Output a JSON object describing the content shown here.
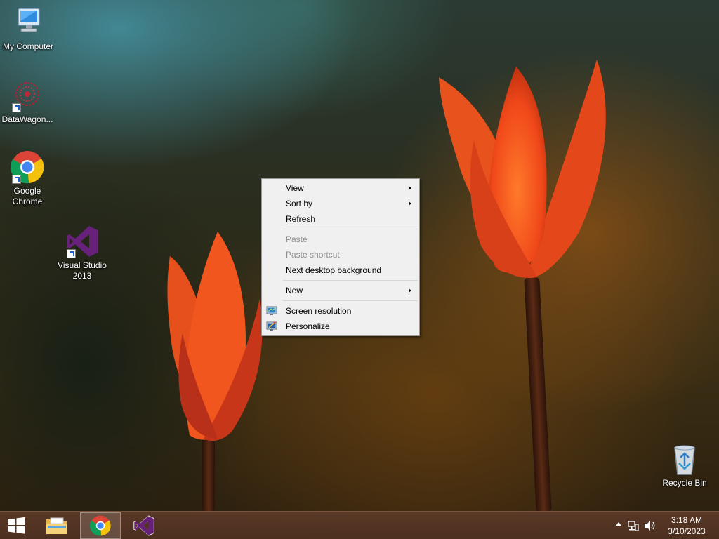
{
  "desktop_icons": [
    {
      "id": "my-computer",
      "label": "My Computer"
    },
    {
      "id": "datawagon",
      "label": "DataWagon..."
    },
    {
      "id": "google-chrome",
      "label": "Google Chrome"
    },
    {
      "id": "visual-studio",
      "label": "Visual Studio 2013"
    },
    {
      "id": "recycle-bin",
      "label": "Recycle Bin"
    }
  ],
  "context_menu": {
    "view": "View",
    "sort_by": "Sort by",
    "refresh": "Refresh",
    "paste": "Paste",
    "paste_shortcut": "Paste shortcut",
    "next_background": "Next desktop background",
    "new": "New",
    "screen_resolution": "Screen resolution",
    "personalize": "Personalize"
  },
  "taskbar": {
    "pinned": [
      "start-button",
      "file-explorer",
      "google-chrome",
      "visual-studio"
    ],
    "active": "google-chrome",
    "clock_time": "3:18 AM",
    "clock_date": "3/10/2023"
  },
  "colors": {
    "accent_vs": "#68217a",
    "chrome_red": "#db4437",
    "chrome_yellow": "#f4c20d",
    "chrome_green": "#0f9d58",
    "chrome_blue": "#4285f4"
  }
}
